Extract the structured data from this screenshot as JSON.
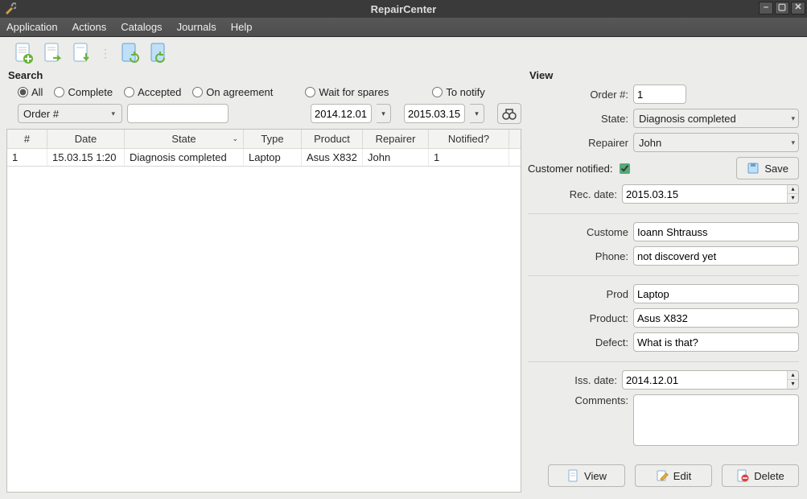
{
  "window": {
    "title": "RepairCenter"
  },
  "menu": {
    "items": [
      "Application",
      "Actions",
      "Catalogs",
      "Journals",
      "Help"
    ]
  },
  "toolbar": {
    "icons": [
      "new-doc-icon",
      "new-doc-right-icon",
      "new-doc-down-icon",
      "doc-sync-a-icon",
      "doc-sync-b-icon"
    ]
  },
  "search": {
    "title": "Search",
    "filters": {
      "all": "All",
      "complete": "Complete",
      "accepted": "Accepted",
      "on_agreement": "On agreement",
      "wait_for_spares": "Wait for spares",
      "to_notify": "To notify",
      "selected": "all"
    },
    "order_combo": "Order #",
    "query": "",
    "date_from": "2014.12.01",
    "date_to": "2015.03.15"
  },
  "grid": {
    "columns": [
      "#",
      "Date",
      "State",
      "Type",
      "Product",
      "Repairer",
      "Notified?"
    ],
    "sort_col": "State",
    "rows": [
      {
        "num": "1",
        "date": "15.03.15 1:20",
        "state": "Diagnosis completed",
        "type": "Laptop",
        "product": "Asus X832",
        "repairer": "John",
        "notified": "1"
      }
    ]
  },
  "view": {
    "title": "View",
    "labels": {
      "order": "Order #:",
      "state": "State:",
      "repairer": "Repairer",
      "customer_notified": "Customer notified:",
      "save": "Save",
      "rec_date": "Rec. date:",
      "customer": "Custome",
      "phone": "Phone:",
      "prod": "Prod",
      "product": "Product:",
      "defect": "Defect:",
      "iss_date": "Iss. date:",
      "comments": "Comments:",
      "view_btn": "View",
      "edit_btn": "Edit",
      "delete_btn": "Delete"
    },
    "values": {
      "order": "1",
      "state": "Diagnosis completed",
      "repairer": "John",
      "notified": true,
      "rec_date": "2015.03.15",
      "customer": "Ioann Shtrauss",
      "phone": "not discoverd yet",
      "prod": "Laptop",
      "product": "Asus X832",
      "defect": "What is that?",
      "iss_date": "2014.12.01",
      "comments": ""
    }
  }
}
